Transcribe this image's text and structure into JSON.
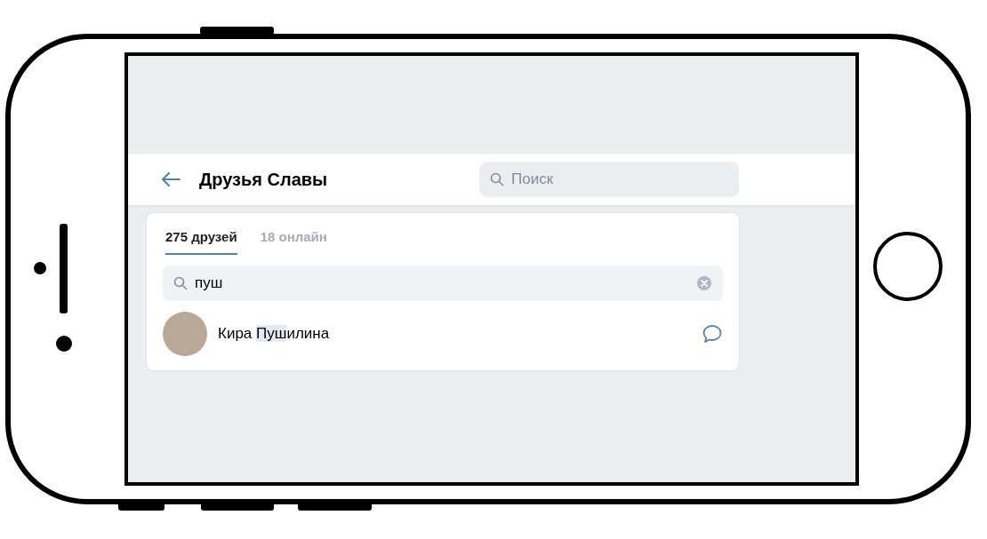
{
  "header": {
    "title": "Друзья Славы",
    "search": {
      "placeholder": "Поиск"
    }
  },
  "tabs": [
    {
      "label": "275 друзей",
      "selected": true
    },
    {
      "label": "18 онлайн",
      "selected": false
    }
  ],
  "friend_search": {
    "value": "пуш"
  },
  "friends": [
    {
      "name": {
        "before": "Кира ",
        "match": "Пуш",
        "after": "илина"
      }
    }
  ]
}
